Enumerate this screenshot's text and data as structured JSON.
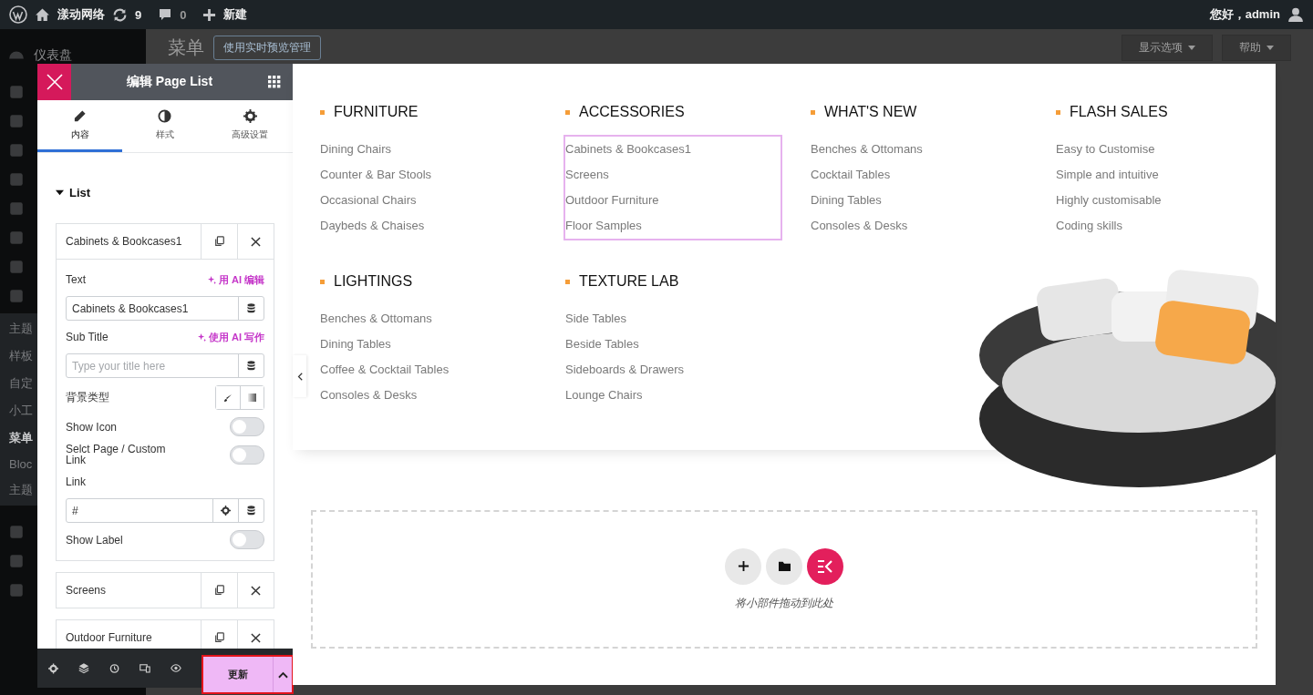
{
  "admin_bar": {
    "site_name": "漾动网络",
    "updates": "9",
    "comments": "0",
    "new": "新建",
    "greeting": "您好，admin"
  },
  "admin_sidebar": {
    "top_item": "仪表盘",
    "submenu": [
      {
        "label": "主题",
        "selected": false
      },
      {
        "label": "样板",
        "selected": false
      },
      {
        "label": "自定",
        "selected": false
      },
      {
        "label": "小工",
        "selected": false
      },
      {
        "label": "菜单",
        "selected": true
      },
      {
        "label": "Bloc",
        "selected": false
      },
      {
        "label": "主题",
        "selected": false
      }
    ]
  },
  "admin_page": {
    "title": "菜单",
    "live_preview_button": "使用实时预览管理",
    "screen_options": "显示选项",
    "help": "帮助"
  },
  "editor": {
    "title": "编辑 Page List",
    "tabs": [
      {
        "label": "内容",
        "kind": "pencil",
        "selected": true
      },
      {
        "label": "样式",
        "kind": "contrast",
        "selected": false
      },
      {
        "label": "高级设置",
        "kind": "gear",
        "selected": false
      }
    ],
    "section": {
      "title": "List",
      "expanded": true
    },
    "items": [
      {
        "label": "Cabinets & Bookcases1",
        "expanded": true
      },
      {
        "label": "Screens",
        "expanded": false
      },
      {
        "label": "Outdoor Furniture",
        "expanded": false
      }
    ],
    "fields": [
      {
        "kind": "text",
        "label": "Text",
        "ai_action": "用 AI 编辑",
        "value": "Cabinets & Bookcases1"
      },
      {
        "kind": "text",
        "label": "Sub Title",
        "ai_action": "使用 AI 写作",
        "placeholder": "Type your title here"
      },
      {
        "kind": "background",
        "label": "背景类型"
      },
      {
        "kind": "toggle",
        "label": "Show Icon",
        "on": false
      },
      {
        "kind": "toggle",
        "label": "Selct Page / Custom Link",
        "on": false
      },
      {
        "kind": "link",
        "label": "Link",
        "value": "#"
      },
      {
        "kind": "toggle",
        "label": "Show Label",
        "on": false
      }
    ],
    "update_button": "更新"
  },
  "preview": {
    "menu_groups": [
      {
        "title": "FURNITURE",
        "selected": false,
        "items": [
          "Dining Chairs",
          "Counter & Bar Stools",
          "Occasional Chairs",
          "Daybeds & Chaises"
        ]
      },
      {
        "title": "ACCESSORIES",
        "selected": true,
        "items": [
          "Cabinets & Bookcases1",
          "Screens",
          "Outdoor Furniture",
          "Floor Samples"
        ]
      },
      {
        "title": "WHAT'S NEW",
        "selected": false,
        "items": [
          "Benches & Ottomans",
          "Cocktail Tables",
          "Dining Tables",
          "Consoles & Desks"
        ]
      },
      {
        "title": "FLASH SALES",
        "selected": false,
        "items": [
          "Easy to Customise",
          "Simple and intuitive",
          "Highly customisable",
          "Coding skills"
        ]
      },
      {
        "title": "LIGHTINGS",
        "selected": false,
        "items": [
          "Benches & Ottomans",
          "Dining Tables",
          "Coffee & Cocktail Tables",
          "Consoles & Desks"
        ]
      },
      {
        "title": "TEXTURE LAB",
        "selected": false,
        "items": [
          "Side Tables",
          "Beside Tables",
          "Sideboards & Drawers",
          "Lounge Chairs"
        ]
      }
    ],
    "drop_hint": "将小部件拖动到此处"
  }
}
